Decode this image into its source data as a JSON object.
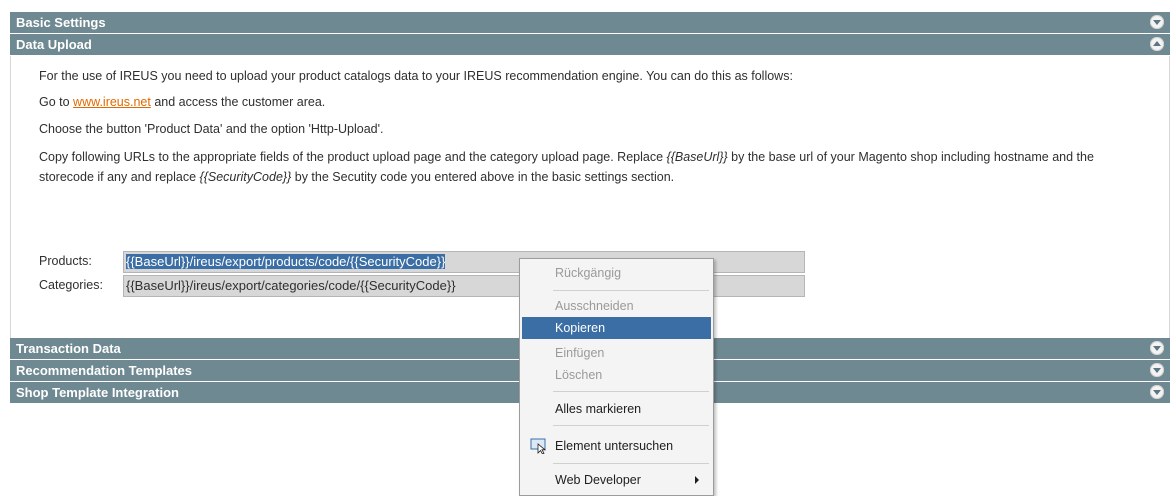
{
  "sections": {
    "basic_settings": "Basic Settings",
    "data_upload": "Data Upload",
    "transaction_data": "Transaction Data",
    "recommendation_templates": "Recommendation Templates",
    "shop_template_integration": "Shop Template Integration"
  },
  "content": {
    "para1": "For the use of IREUS you need to upload your product catalogs data to your IREUS recommendation engine. You can do this as follows:",
    "para2_prefix": "Go to ",
    "para2_link": "www.ireus.net",
    "para2_suffix": " and access the customer area.",
    "para3": "Choose the button 'Product Data' and the option 'Http-Upload'.",
    "para4_a": "Copy following URLs to the appropriate fields of the product upload page and the category upload page. Replace ",
    "para4_baseurl": "{{BaseUrl}}",
    "para4_b": " by the base url of your Magento shop including hostname and the storecode if any and replace ",
    "para4_seccode": "{{SecurityCode}}",
    "para4_c": " by the Secutity code you entered above in the basic settings section.",
    "products_label": "Products:",
    "products_url": "{{BaseUrl}}/ireus/export/products/code/{{SecurityCode}}",
    "categories_label": "Categories:",
    "categories_url": "{{BaseUrl}}/ireus/export/categories/code/{{SecurityCode}}"
  },
  "context_menu": {
    "undo": "Rückgängig",
    "cut": "Ausschneiden",
    "copy": "Kopieren",
    "paste": "Einfügen",
    "delete": "Löschen",
    "select_all": "Alles markieren",
    "inspect": "Element untersuchen",
    "web_developer": "Web Developer"
  },
  "colors": {
    "header_bar": "#6f8992",
    "link": "#e06a00",
    "selection": "#3a6ea5"
  }
}
